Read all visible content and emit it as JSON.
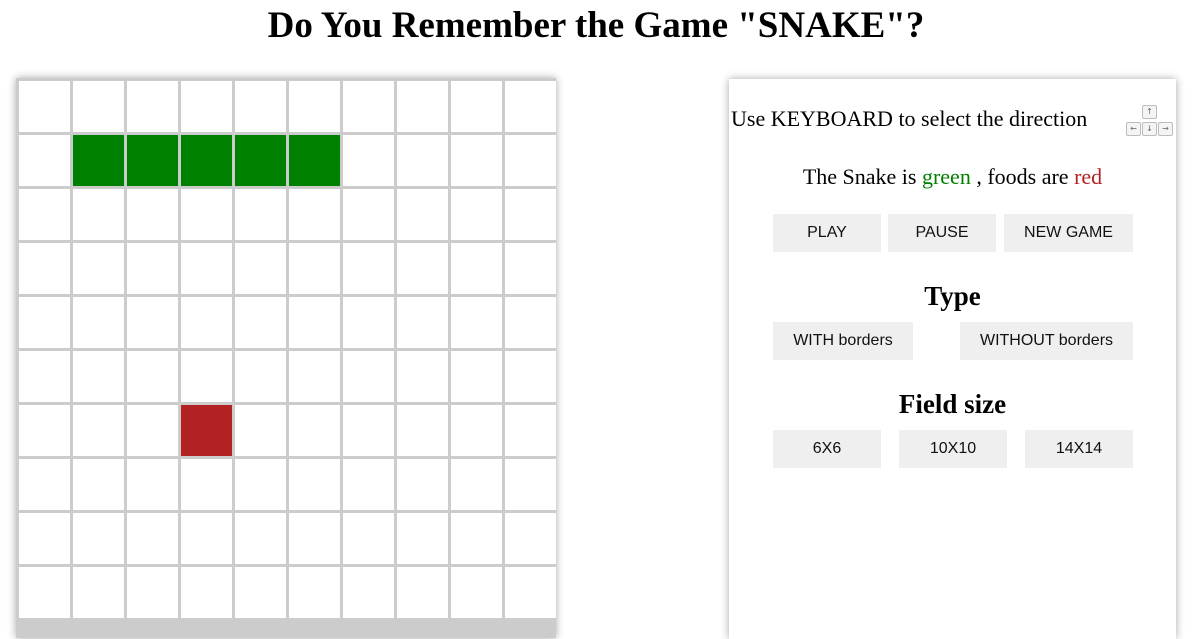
{
  "title": "Do You Remember the Game \"SNAKE\"?",
  "board": {
    "rows": 10,
    "cols": 10,
    "snake": [
      [
        1,
        1
      ],
      [
        1,
        2
      ],
      [
        1,
        3
      ],
      [
        1,
        4
      ],
      [
        1,
        5
      ]
    ],
    "food": [
      [
        6,
        3
      ]
    ],
    "colors": {
      "snake": "#008000",
      "food": "#b22222",
      "cell": "#ffffff",
      "grid": "#cccccc"
    }
  },
  "panel": {
    "instruction": "Use KEYBOARD to select the direction",
    "keys": {
      "up": "↑",
      "left": "←",
      "down": "↓",
      "right": "→"
    },
    "legend": {
      "prefix": "The Snake is",
      "snake_word": "green",
      "middle": ", foods are",
      "food_word": "red"
    },
    "controls": {
      "play": "PLAY",
      "pause": "PAUSE",
      "new_game": "NEW GAME"
    },
    "type": {
      "heading": "Type",
      "with_borders": "WITH borders",
      "without_borders": "WITHOUT borders"
    },
    "field_size": {
      "heading": "Field size",
      "options": [
        "6X6",
        "10X10",
        "14X14"
      ]
    }
  }
}
